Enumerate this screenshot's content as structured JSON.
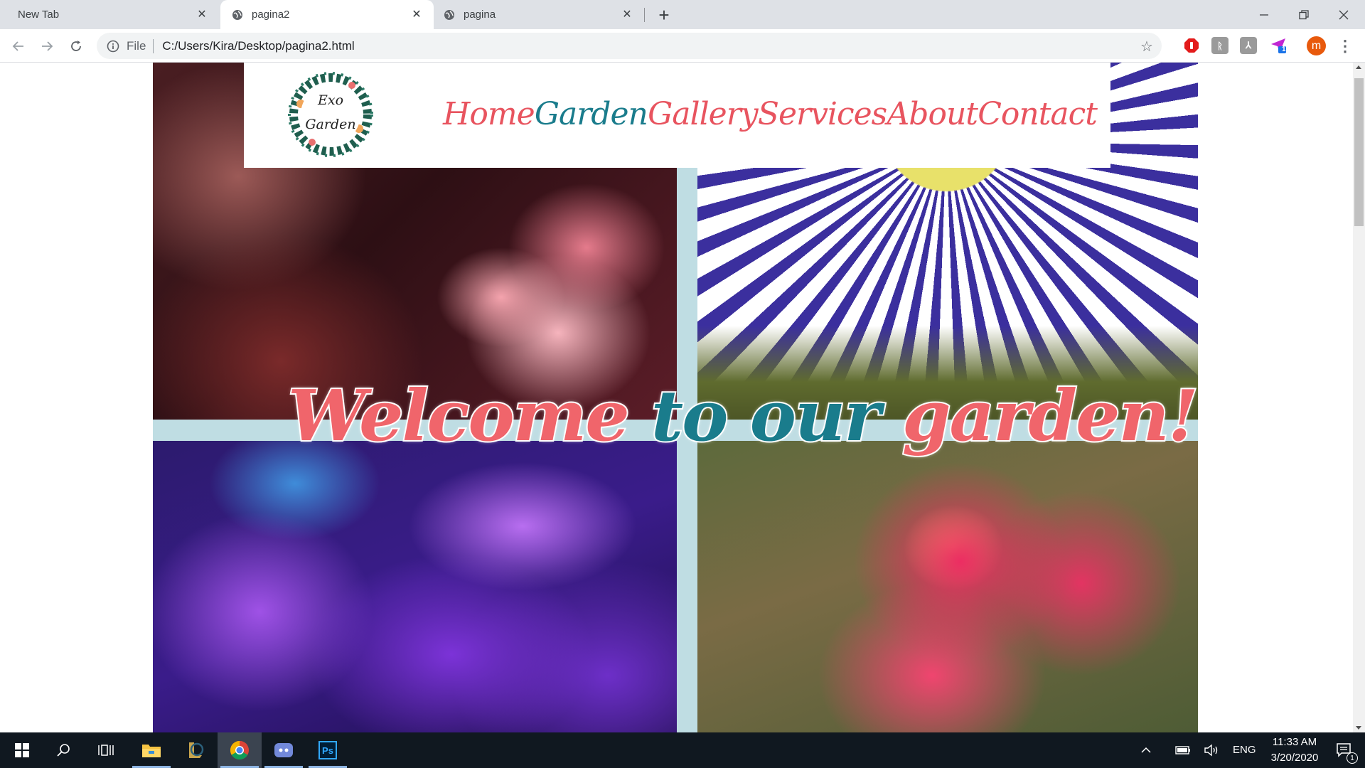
{
  "browser": {
    "tabs": [
      {
        "title": "New Tab",
        "active": false
      },
      {
        "title": "pagina2",
        "active": true
      },
      {
        "title": "pagina",
        "active": false
      }
    ],
    "omnibox": {
      "scheme_label": "File",
      "url": "C:/Users/Kira/Desktop/pagina2.html"
    },
    "profile_initial": "m",
    "extension_badge": "1"
  },
  "site": {
    "logo": {
      "line1": "Exo",
      "line2": "Garden"
    },
    "nav": [
      {
        "label": "Home",
        "color": "#e8545f"
      },
      {
        "label": "Garden",
        "color": "#1a7c8c"
      },
      {
        "label": "Gallery",
        "color": "#e8545f"
      },
      {
        "label": "Services",
        "color": "#e8545f"
      },
      {
        "label": "About",
        "color": "#e8545f"
      },
      {
        "label": "Contact",
        "color": "#e8545f"
      }
    ],
    "welcome": {
      "part1": "Welcome ",
      "part2": "to our ",
      "part3": "garden!",
      "color_pink": "#f0656b",
      "color_teal": "#1a7c8c"
    },
    "divider_color": "#bfdde3"
  },
  "taskbar": {
    "language": "ENG",
    "time": "11:33 AM",
    "date": "3/20/2020",
    "notification_count": "1",
    "apps": [
      "start-icon",
      "search-icon",
      "task-view-icon",
      "file-explorer-icon",
      "league-of-legends-icon",
      "chrome-icon",
      "discord-icon",
      "photoshop-icon"
    ],
    "photoshop_label": "Ps"
  }
}
